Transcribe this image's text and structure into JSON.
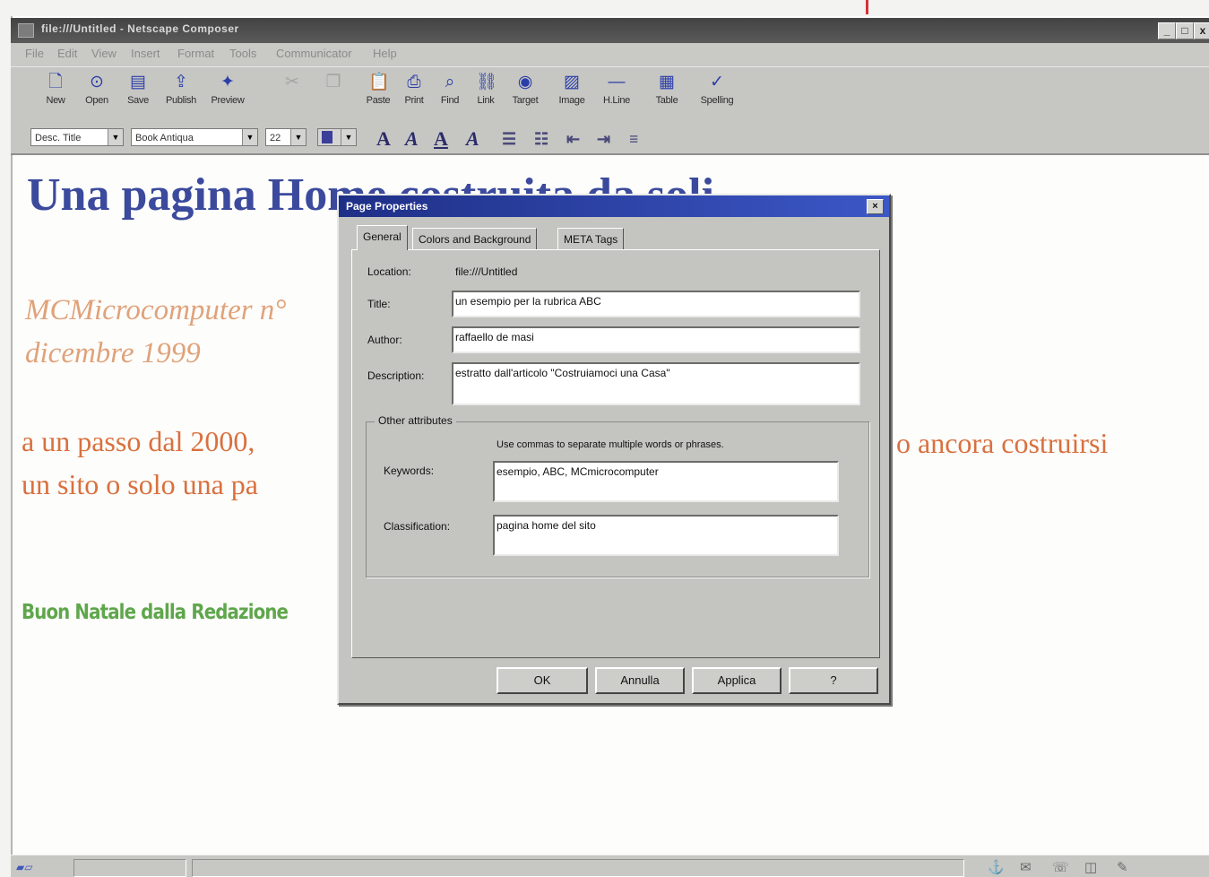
{
  "window": {
    "title": "file:///Untitled - Netscape Composer",
    "buttons": [
      "_",
      "□",
      "x"
    ]
  },
  "menu": [
    "File",
    "Edit",
    "View",
    "Insert",
    "Format",
    "Tools",
    "Communicator",
    "Help"
  ],
  "toolbar": [
    {
      "label": "New",
      "icon": "new-doc-icon",
      "glyph": "🗋",
      "enabled": true
    },
    {
      "label": "Open",
      "icon": "open-icon",
      "glyph": "⊙",
      "enabled": true
    },
    {
      "label": "Save",
      "icon": "save-icon",
      "glyph": "▤",
      "enabled": true
    },
    {
      "label": "Publish",
      "icon": "publish-icon",
      "glyph": "⇪",
      "enabled": true
    },
    {
      "label": "Preview",
      "icon": "preview-icon",
      "glyph": "✦",
      "enabled": true
    },
    {
      "label": "",
      "icon": "cut-icon",
      "glyph": "✂",
      "enabled": false
    },
    {
      "label": "",
      "icon": "copy-icon",
      "glyph": "❐",
      "enabled": false
    },
    {
      "label": "Paste",
      "icon": "paste-icon",
      "glyph": "📋",
      "enabled": true
    },
    {
      "label": "Print",
      "icon": "print-icon",
      "glyph": "⎙",
      "enabled": true
    },
    {
      "label": "Find",
      "icon": "find-icon",
      "glyph": "⌕",
      "enabled": true
    },
    {
      "label": "Link",
      "icon": "link-icon",
      "glyph": "⛓",
      "enabled": true
    },
    {
      "label": "Target",
      "icon": "target-icon",
      "glyph": "◉",
      "enabled": true
    },
    {
      "label": "Image",
      "icon": "image-icon",
      "glyph": "▨",
      "enabled": true
    },
    {
      "label": "H.Line",
      "icon": "hline-icon",
      "glyph": "—",
      "enabled": true
    },
    {
      "label": "Table",
      "icon": "table-icon",
      "glyph": "▦",
      "enabled": true
    },
    {
      "label": "Spelling",
      "icon": "spelling-icon",
      "glyph": "✓",
      "enabled": true
    }
  ],
  "format_bar": {
    "paragraph_style": "Desc. Title",
    "font": "Book Antiqua",
    "size": "22",
    "buttons": [
      "A",
      "A",
      "A",
      "A",
      "☰",
      "☷",
      "⇤",
      "⇥",
      "≡"
    ]
  },
  "document": {
    "heading": "Una pagina H",
    "heading_tail": "ome costruita da soli",
    "subtitle_line1": "MCMicrocomputer n°",
    "subtitle_line2": "dicembre 1999",
    "para_line1": "a un passo dal 2000,",
    "para_line2": "un sito o solo una pa",
    "para_right": "o ancora costruirsi",
    "greeting": "Buon Natale dalla Redazione"
  },
  "dialog": {
    "title": "Page Properties",
    "tabs": [
      "General",
      "Colors and Background",
      "META Tags"
    ],
    "location_label": "Location:",
    "location_value": "file:///Untitled",
    "title_label": "Title:",
    "title_value": "un esempio per la rubrica ABC",
    "author_label": "Author:",
    "author_value": "raffaello de masi",
    "description_label": "Description:",
    "description_value": "estratto dall'articolo \"Costruiamoci una Casa\"",
    "other_attributes": "Other attributes",
    "hint": "Use commas to separate multiple words or phrases.",
    "keywords_label": "Keywords:",
    "keywords_value": "esempio, ABC, MCmicrocomputer",
    "classification_label": "Classification:",
    "classification_value": "pagina home del sito",
    "buttons": {
      "ok": "OK",
      "cancel": "Annulla",
      "apply": "Applica",
      "help": "?"
    }
  },
  "colors": {
    "heading": "#3b4a9c",
    "subtitle": "#e0a27a",
    "paragraph": "#d9703f",
    "greeting": "#5fa64c",
    "dialog_title": "#1e2f86"
  }
}
